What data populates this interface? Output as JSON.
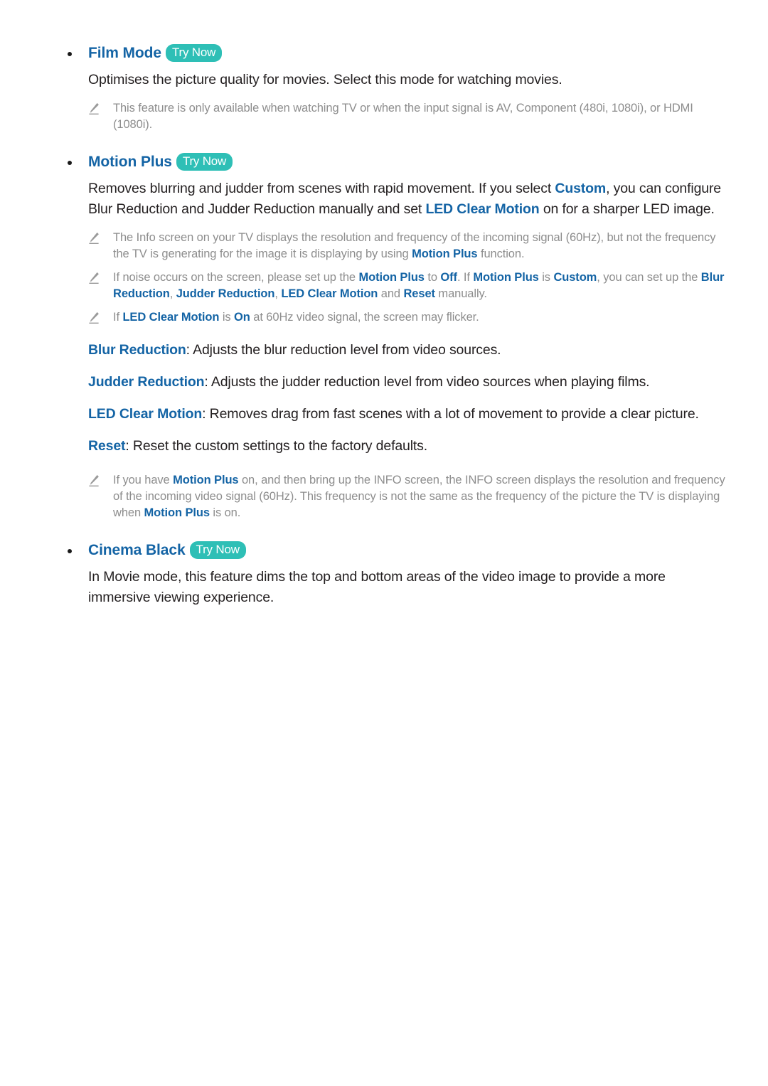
{
  "document": {
    "title": "Picture Settings — Film Mode / Motion Plus / Cinema Black",
    "try_now_label": "Try Now",
    "colors": {
      "heading_blue": "#1464a5",
      "term_blue": "#1464a5",
      "badge_teal": "#2ebfb6",
      "body_text": "#231f20",
      "note_text": "#8d8d8d"
    }
  },
  "sections": [
    {
      "id": "film-mode",
      "heading": "Film Mode",
      "has_try_now": true,
      "body": "Optimises the picture quality for movies. Select this mode for watching movies.",
      "notes": [
        {
          "parts": [
            {
              "text": "This feature is only available when watching TV or when the input signal is AV, Component (480i, 1080i), or HDMI (1080i).",
              "style": "grey"
            }
          ]
        }
      ]
    },
    {
      "id": "motion-plus",
      "heading": "Motion Plus",
      "has_try_now": true,
      "body_parts": [
        {
          "text": "Removes blurring and judder from scenes with rapid movement. If you select ",
          "style": "plain"
        },
        {
          "text": "Custom",
          "style": "blue"
        },
        {
          "text": ", you can configure Blur Reduction and Judder Reduction manually and set ",
          "style": "plain"
        },
        {
          "text": "LED Clear Motion",
          "style": "blue"
        },
        {
          "text": " on for a sharper LED image.",
          "style": "plain"
        }
      ],
      "notes": [
        {
          "parts": [
            {
              "text": "The Info screen on your TV displays the resolution and frequency of the incoming signal (60Hz), but not the frequency the TV is generating for the image it is displaying by using ",
              "style": "grey"
            },
            {
              "text": "Motion Plus",
              "style": "blue"
            },
            {
              "text": " function.",
              "style": "grey"
            }
          ]
        },
        {
          "parts": [
            {
              "text": "If noise occurs on the screen, please set up the ",
              "style": "grey"
            },
            {
              "text": "Motion Plus",
              "style": "blue"
            },
            {
              "text": " to ",
              "style": "grey"
            },
            {
              "text": "Off",
              "style": "blue"
            },
            {
              "text": ". If ",
              "style": "grey"
            },
            {
              "text": "Motion Plus",
              "style": "blue"
            },
            {
              "text": " is ",
              "style": "grey"
            },
            {
              "text": "Custom",
              "style": "blue"
            },
            {
              "text": ", you can set up the ",
              "style": "grey"
            },
            {
              "text": "Blur Reduction",
              "style": "blue"
            },
            {
              "text": ", ",
              "style": "grey"
            },
            {
              "text": "Judder Reduction",
              "style": "blue"
            },
            {
              "text": ", ",
              "style": "grey"
            },
            {
              "text": "LED Clear Motion",
              "style": "blue"
            },
            {
              "text": " and ",
              "style": "grey"
            },
            {
              "text": "Reset",
              "style": "blue"
            },
            {
              "text": " manually.",
              "style": "grey"
            }
          ]
        },
        {
          "parts": [
            {
              "text": "If ",
              "style": "grey"
            },
            {
              "text": "LED Clear Motion",
              "style": "blue"
            },
            {
              "text": " is ",
              "style": "grey"
            },
            {
              "text": "On",
              "style": "blue"
            },
            {
              "text": " at 60Hz video signal, the screen may flicker.",
              "style": "grey"
            }
          ]
        }
      ],
      "terms": [
        {
          "term": "Blur Reduction",
          "definition": ": Adjusts the blur reduction level from video sources."
        },
        {
          "term": "Judder Reduction",
          "definition": ": Adjusts the judder reduction level from video sources when playing films."
        },
        {
          "term": "LED Clear Motion",
          "definition": ": Removes drag from fast scenes with a lot of movement to provide a clear picture."
        },
        {
          "term": "Reset",
          "definition": ": Reset the custom settings to the factory defaults."
        }
      ],
      "trailing_notes": [
        {
          "parts": [
            {
              "text": "If you have ",
              "style": "grey"
            },
            {
              "text": "Motion Plus",
              "style": "blue"
            },
            {
              "text": " on, and then bring up the INFO screen, the INFO screen displays the resolution and frequency of the incoming video signal (60Hz). This frequency is not the same as the frequency of the picture the TV is displaying when ",
              "style": "grey"
            },
            {
              "text": "Motion Plus",
              "style": "blue"
            },
            {
              "text": " is on.",
              "style": "grey"
            }
          ]
        }
      ]
    },
    {
      "id": "cinema-black",
      "heading": "Cinema Black",
      "has_try_now": true,
      "body": "In Movie mode, this feature dims the top and bottom areas of the video image to provide a more immersive viewing experience."
    }
  ]
}
